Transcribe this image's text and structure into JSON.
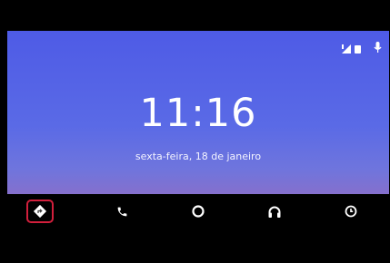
{
  "clock": {
    "time": "11:16",
    "date": "sexta-feira, 18 de janeiro"
  },
  "status_bar": {
    "icons": [
      "signal-icon",
      "battery-icon",
      "microphone-icon"
    ]
  },
  "nav_bar": {
    "items": [
      {
        "name": "navigation",
        "icon": "navigation-icon",
        "selected": true
      },
      {
        "name": "phone",
        "icon": "phone-icon",
        "selected": false
      },
      {
        "name": "home",
        "icon": "home-circle-icon",
        "selected": false
      },
      {
        "name": "music",
        "icon": "headphones-icon",
        "selected": false
      },
      {
        "name": "exit",
        "icon": "power-clock-icon",
        "selected": false
      }
    ]
  },
  "colors": {
    "highlight": "#d21f3c",
    "background_top": "#4e5be6",
    "background_bottom": "#a274c6"
  }
}
